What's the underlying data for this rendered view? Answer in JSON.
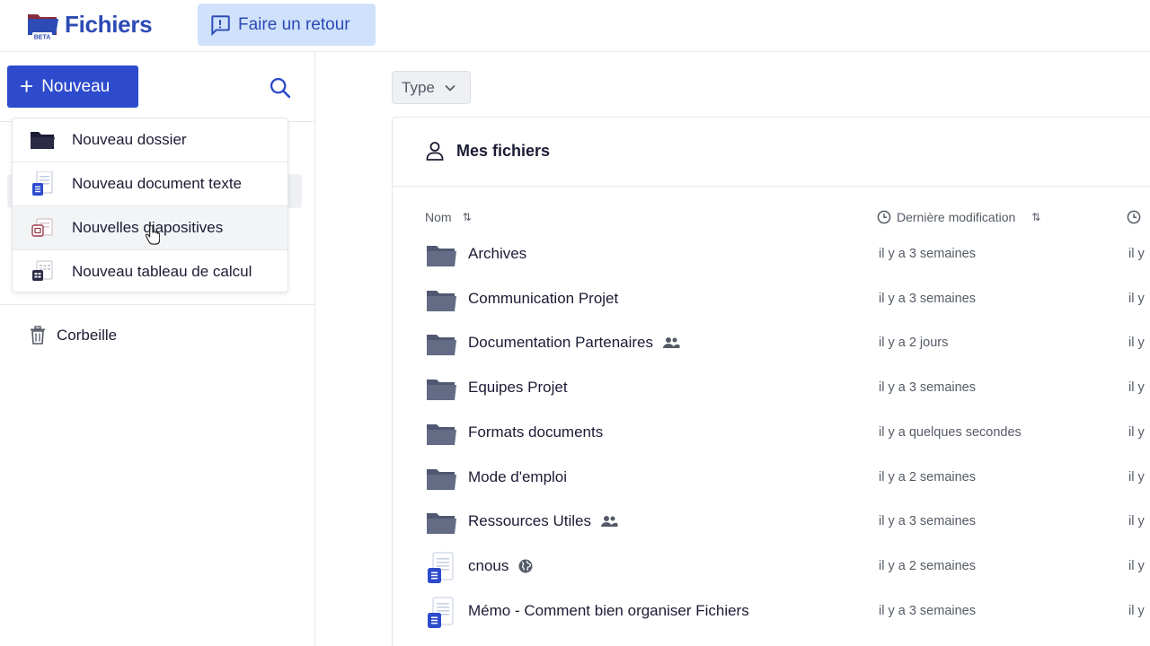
{
  "header": {
    "app_title": "Fichiers",
    "beta_label": "BETA",
    "feedback_label": "Faire un retour"
  },
  "sidebar": {
    "new_label": "Nouveau",
    "trash_label": "Corbeille"
  },
  "new_menu": {
    "items": [
      {
        "label": "Nouveau dossier",
        "icon": "folder-icon"
      },
      {
        "label": "Nouveau document texte",
        "icon": "text-document-icon"
      },
      {
        "label": "Nouvelles diapositives",
        "icon": "slides-icon"
      },
      {
        "label": "Nouveau tableau de calcul",
        "icon": "spreadsheet-icon"
      }
    ]
  },
  "filters": {
    "type_label": "Type"
  },
  "main": {
    "title": "Mes fichiers",
    "columns": {
      "name": "Nom",
      "modified": "Dernière modification"
    },
    "rows": [
      {
        "name": "Archives",
        "modified": "il y a 3 semaines",
        "extra": "il y",
        "type": "folder",
        "badge": ""
      },
      {
        "name": "Communication Projet",
        "modified": "il y a 3 semaines",
        "extra": "il y",
        "type": "folder",
        "badge": ""
      },
      {
        "name": "Documentation Partenaires",
        "modified": "il y a 2 jours",
        "extra": "il y",
        "type": "folder",
        "badge": "shared"
      },
      {
        "name": "Equipes Projet",
        "modified": "il y a 3 semaines",
        "extra": "il y",
        "type": "folder",
        "badge": ""
      },
      {
        "name": "Formats documents",
        "modified": "il y a quelques secondes",
        "extra": "il y",
        "type": "folder",
        "badge": ""
      },
      {
        "name": "Mode d'emploi",
        "modified": "il y a 2 semaines",
        "extra": "il y",
        "type": "folder",
        "badge": ""
      },
      {
        "name": "Ressources Utiles",
        "modified": "il y a 3 semaines",
        "extra": "il y",
        "type": "folder",
        "badge": "shared"
      },
      {
        "name": "cnous",
        "modified": "il y a 2 semaines",
        "extra": "il y",
        "type": "document",
        "badge": "public"
      },
      {
        "name": "Mémo - Comment bien organiser Fichiers",
        "modified": "il y a 3 semaines",
        "extra": "il y",
        "type": "document",
        "badge": ""
      }
    ]
  },
  "colors": {
    "accent": "#2d4bcc",
    "brand_text": "#2d4bb5",
    "feedback_bg": "#cfe1fb",
    "folder": "#5d6780",
    "muted_text": "#555b66"
  }
}
